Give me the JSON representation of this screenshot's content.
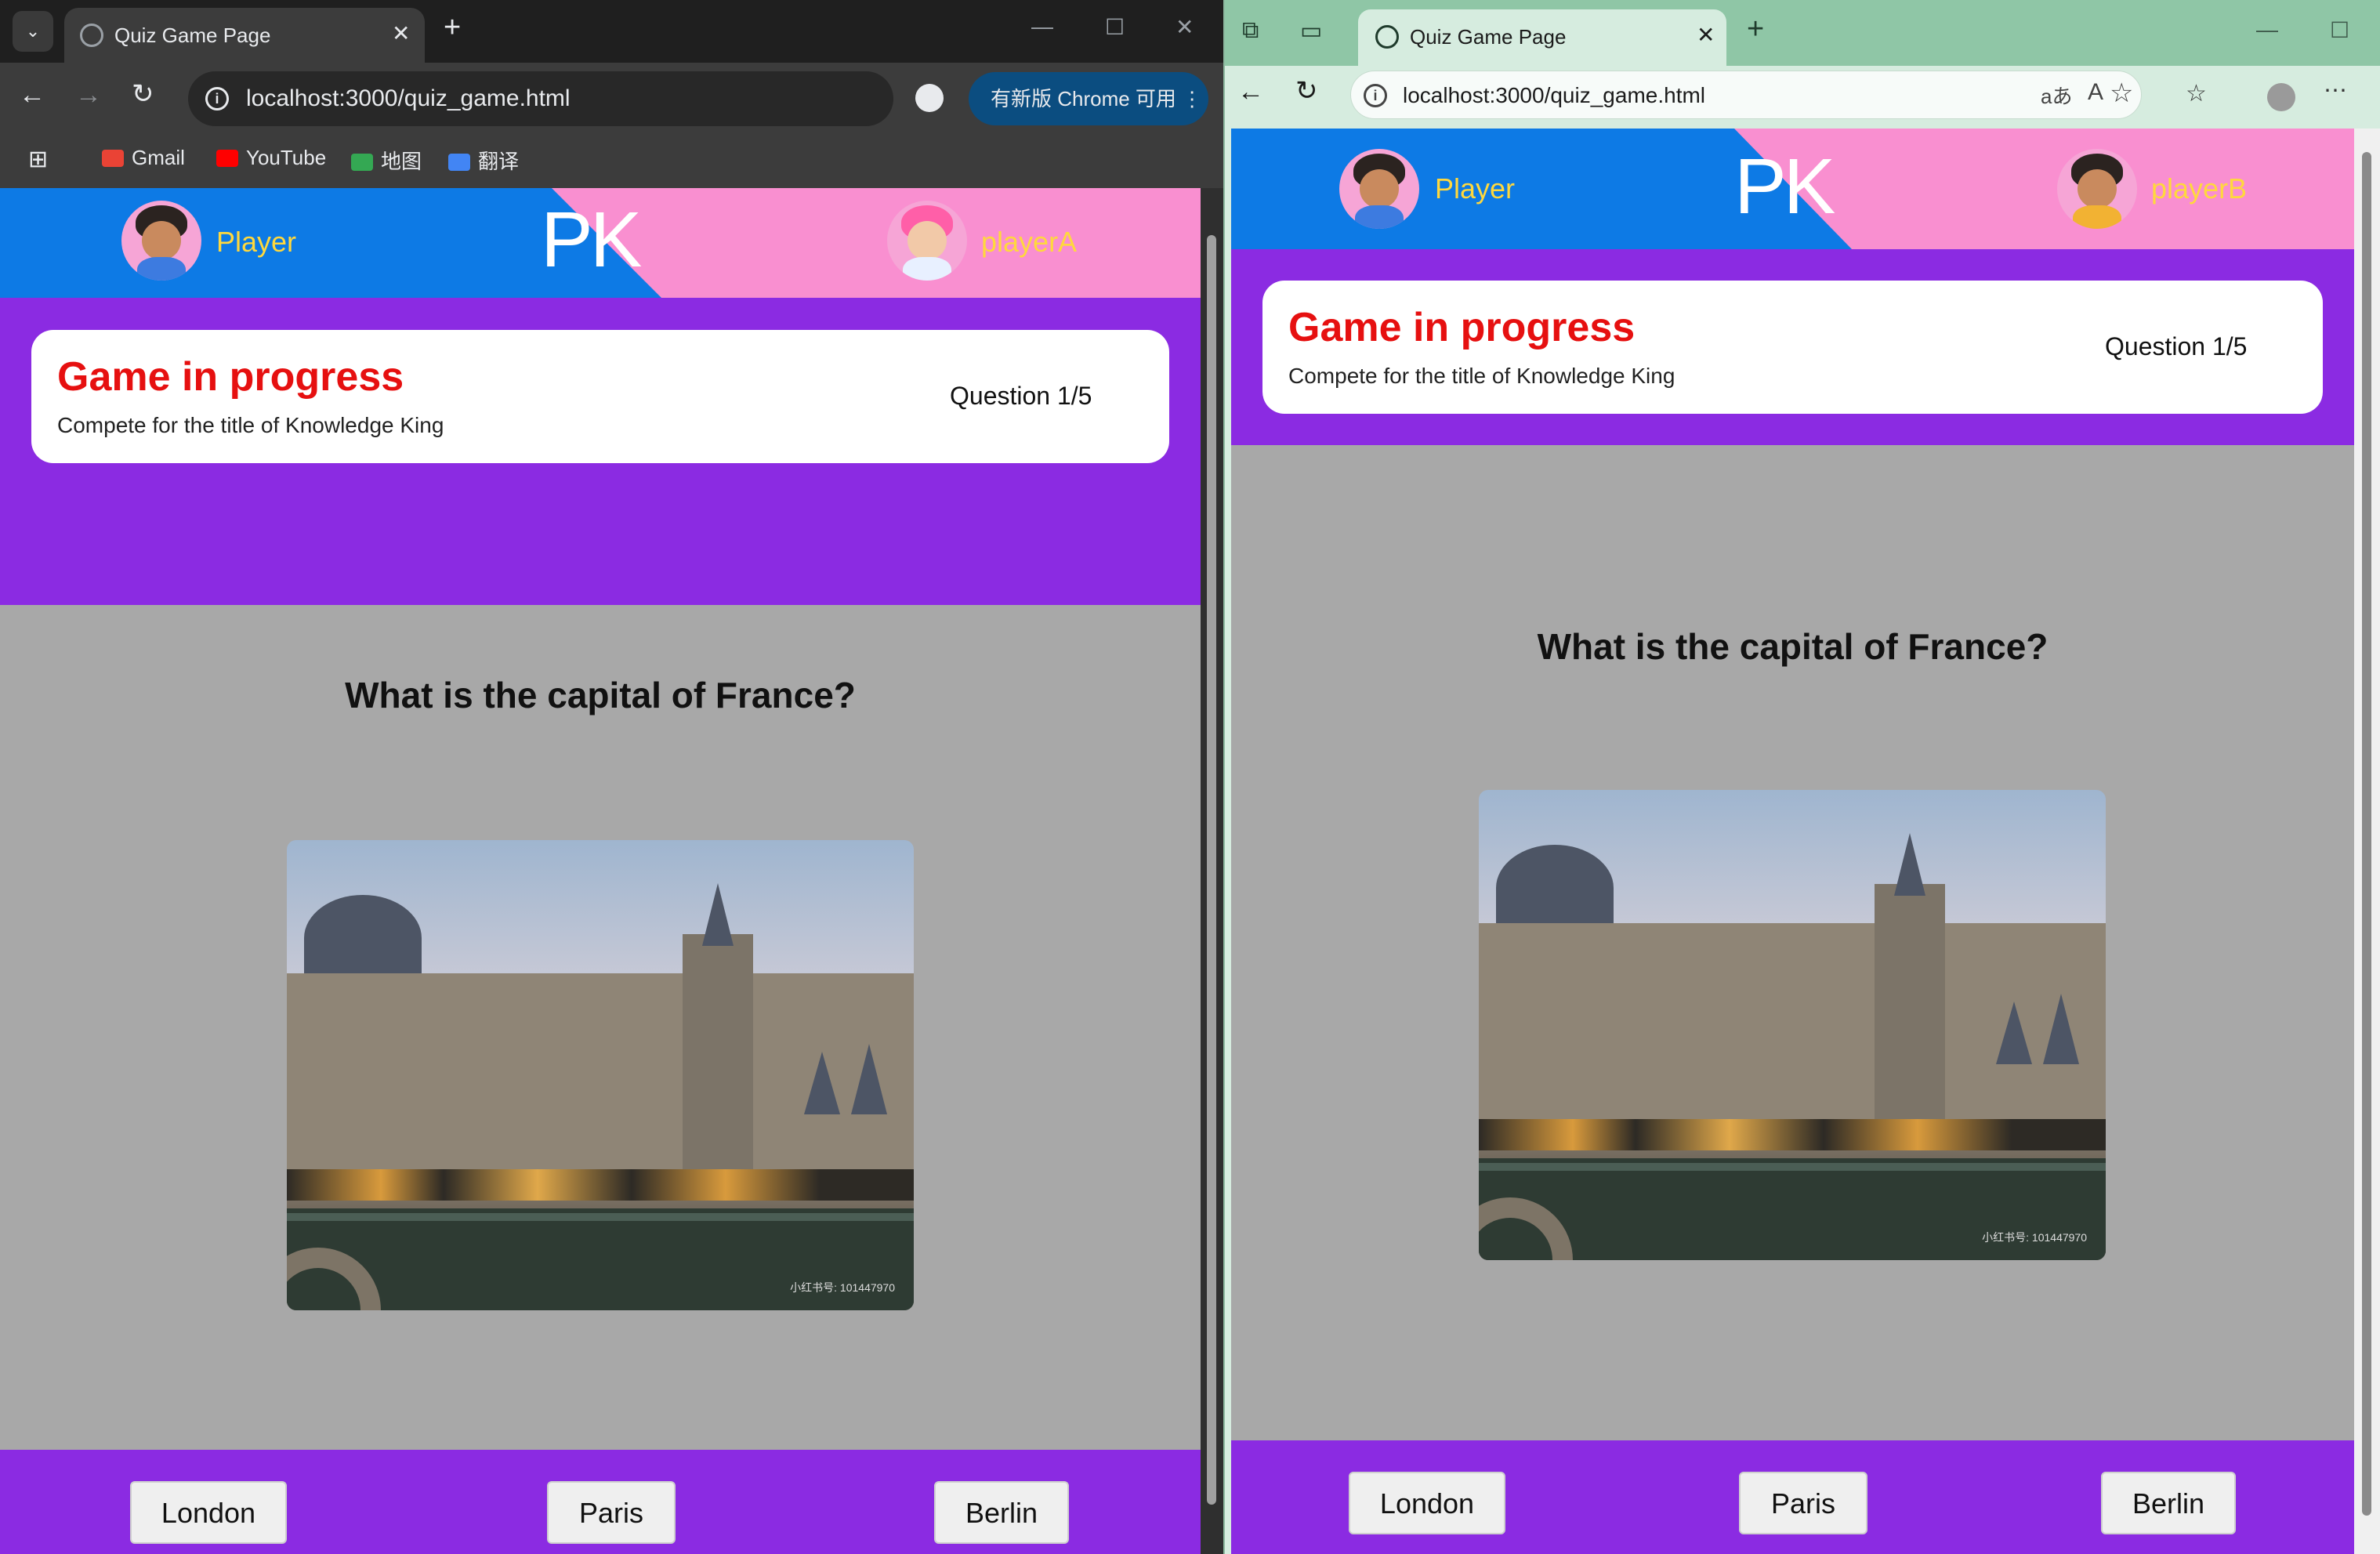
{
  "left_window": {
    "tab_title": "Quiz Game Page",
    "url": "localhost:3000/quiz_game.html",
    "update_button": "有新版 Chrome 可用",
    "bookmarks": [
      "Gmail",
      "YouTube",
      "地图",
      "翻译"
    ]
  },
  "right_window": {
    "tab_title": "Quiz Game Page",
    "url": "localhost:3000/quiz_game.html"
  },
  "game_left": {
    "pk_label": "PK",
    "player_left": "Player",
    "player_right": "playerA",
    "status_title": "Game in progress",
    "status_subtitle": "Compete for the title of Knowledge King",
    "question_counter": "Question 1/5",
    "question": "What is the capital of France?",
    "image_watermark": "小红书号: 101447970",
    "answers": [
      "London",
      "Paris",
      "Berlin"
    ]
  },
  "game_right": {
    "pk_label": "PK",
    "player_left": "Player",
    "player_right": "playerB",
    "status_title": "Game in progress",
    "status_subtitle": "Compete for the title of Knowledge King",
    "question_counter": "Question 1/5",
    "question": "What is the capital of France?",
    "image_watermark": "小红书号: 101447970",
    "answers": [
      "London",
      "Paris",
      "Berlin"
    ]
  },
  "colors": {
    "blue_bar": "#0d7ae5",
    "pink_bar": "#f98fd0",
    "purple": "#8b2be2",
    "status_red": "#e61010",
    "player_name_yellow": "#ffd83d",
    "page_gray": "#a8a8a8"
  },
  "icons": [
    "tab-search-icon",
    "globe-icon",
    "close-icon",
    "plus-icon",
    "back-icon",
    "forward-icon",
    "reload-icon",
    "info-icon",
    "translate-icon",
    "star-icon",
    "profile-icon",
    "more-icon",
    "apps-icon",
    "minimize-icon",
    "maximize-icon"
  ]
}
